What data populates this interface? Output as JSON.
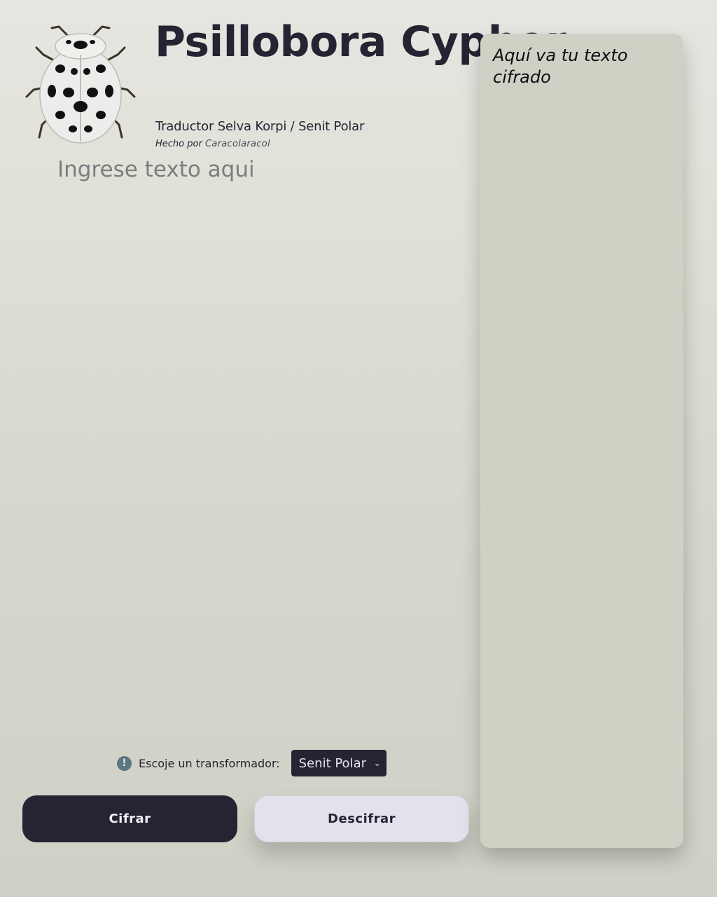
{
  "header": {
    "title": "Psillobora Cypher",
    "subtitle": "Traductor Selva Korpi / Senit Polar",
    "credit_prefix": "Hecho por",
    "credit_author": "Caracolaracol"
  },
  "input": {
    "placeholder": "Ingrese texto aqui",
    "value": ""
  },
  "selector": {
    "icon": "info-icon",
    "label": "Escoje un transformador:",
    "selected": "Senit Polar"
  },
  "buttons": {
    "encrypt_label": "Cifrar",
    "decrypt_label": "Descifrar"
  },
  "output": {
    "placeholder_text": "Aquí va tu texto cifrado"
  },
  "colors": {
    "dark": "#262433",
    "light_button": "#e3e2ec",
    "panel": "#d0d0c5",
    "info_icon": "#5b7582"
  }
}
